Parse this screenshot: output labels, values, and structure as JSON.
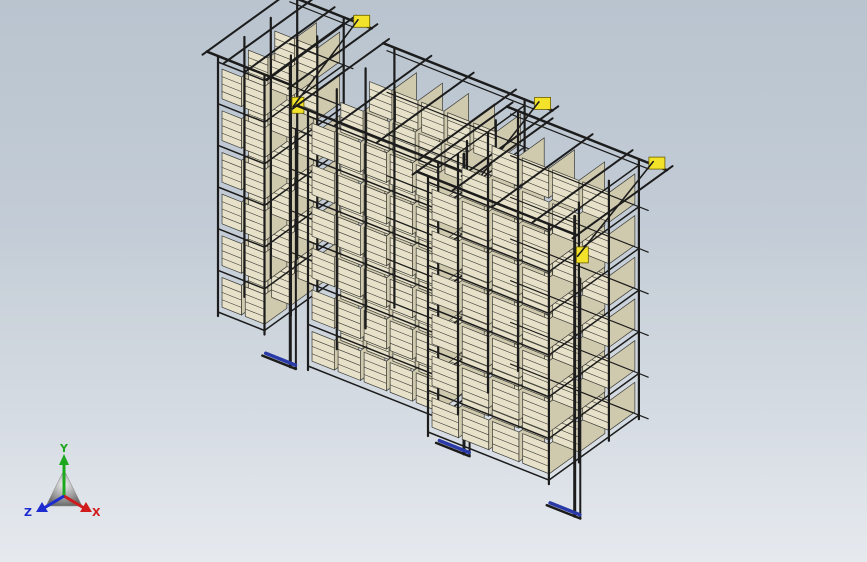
{
  "viewport": {
    "background_top": "#b9c4cf",
    "background_bottom": "#e6eaef"
  },
  "model": {
    "frame_color": "#1c1c1c",
    "pallet_color": "#e6e1c8",
    "pallet_edge_color": "#3a3a34",
    "motor_color": "#f2e22a",
    "base_rail_color": "#2a3aa8",
    "rack_count": 3
  },
  "triad": {
    "x_label": "X",
    "y_label": "Y",
    "z_label": "Z",
    "x_color": "#d01c1c",
    "y_color": "#1ea81e",
    "z_color": "#1c2cd0"
  }
}
